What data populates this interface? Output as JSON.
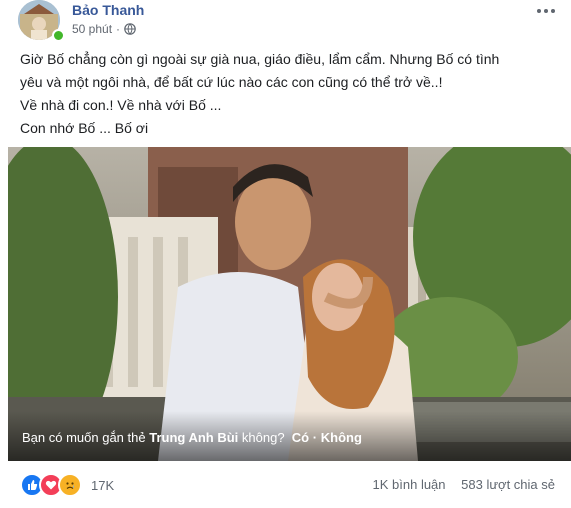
{
  "post": {
    "author": "Bảo Thanh",
    "time": "50 phút",
    "separator": "·",
    "privacy_icon": "globe-icon",
    "more_icon": "more-options-icon",
    "lines": [
      "Giờ Bố chẳng còn gì ngoài sự già nua, giáo điều, lẩm cẩm. Nhưng Bố có tình",
      "yêu và một ngôi nhà, để bất cứ lúc nào các con cũng có thể trở về..!",
      "Về nhà đi con.! Về nhà với Bố ...",
      "Con nhớ Bố ... Bố ơi"
    ]
  },
  "photo_tag": {
    "prompt_prefix": "Bạn có muốn gắn thẻ",
    "name": "Trung Anh Bùi",
    "prompt_suffix": "không?",
    "yes": "Có",
    "dot": "·",
    "no": "Không"
  },
  "reactions": {
    "icons": [
      "like-icon",
      "love-icon",
      "sad-icon"
    ],
    "count": "17K",
    "comments": "1K bình luận",
    "shares": "583 lượt chia sẻ"
  },
  "colors": {
    "author": "#385898",
    "like": "#1877f2",
    "love": "#f33e58",
    "sad": "#f7b125"
  }
}
